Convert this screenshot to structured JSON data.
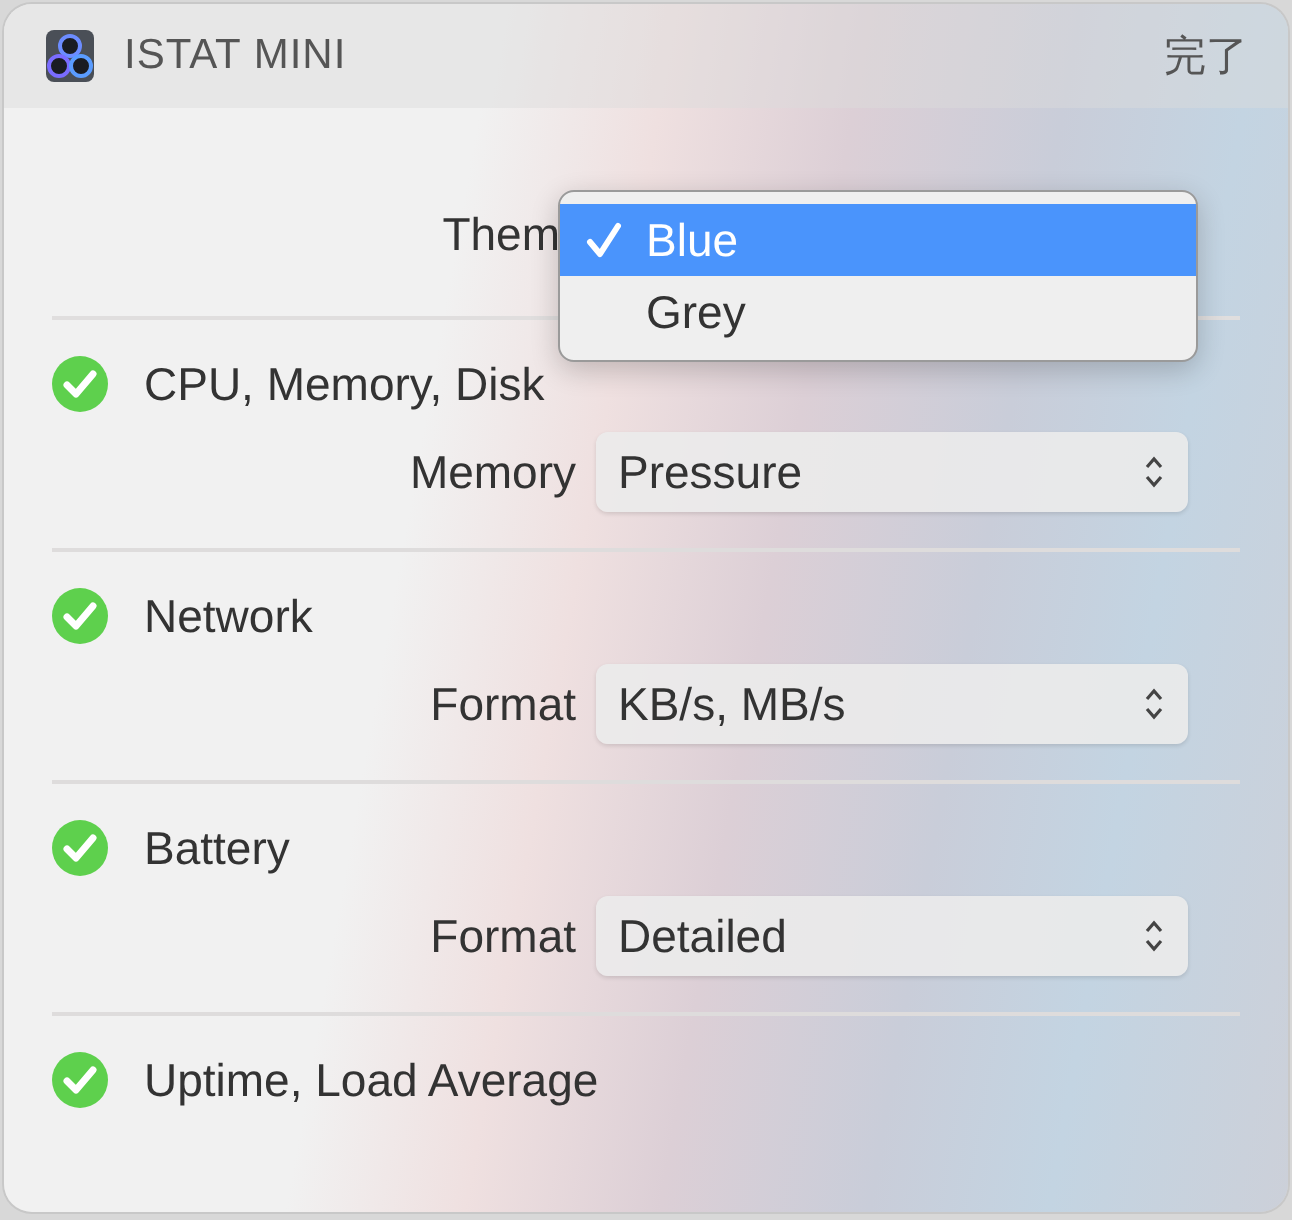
{
  "header": {
    "title": "ISTAT MINI",
    "done_button": "完了"
  },
  "theme": {
    "label": "Them",
    "menu": [
      {
        "label": "Blue",
        "selected": true
      },
      {
        "label": "Grey",
        "selected": false
      }
    ]
  },
  "sections": [
    {
      "name": "CPU, Memory, Disk",
      "checked": true,
      "setting": {
        "label": "Memory",
        "value": "Pressure"
      }
    },
    {
      "name": "Network",
      "checked": true,
      "setting": {
        "label": "Format",
        "value": "KB/s, MB/s"
      }
    },
    {
      "name": "Battery",
      "checked": true,
      "setting": {
        "label": "Format",
        "value": "Detailed"
      }
    },
    {
      "name": "Uptime, Load Average",
      "checked": true
    }
  ]
}
